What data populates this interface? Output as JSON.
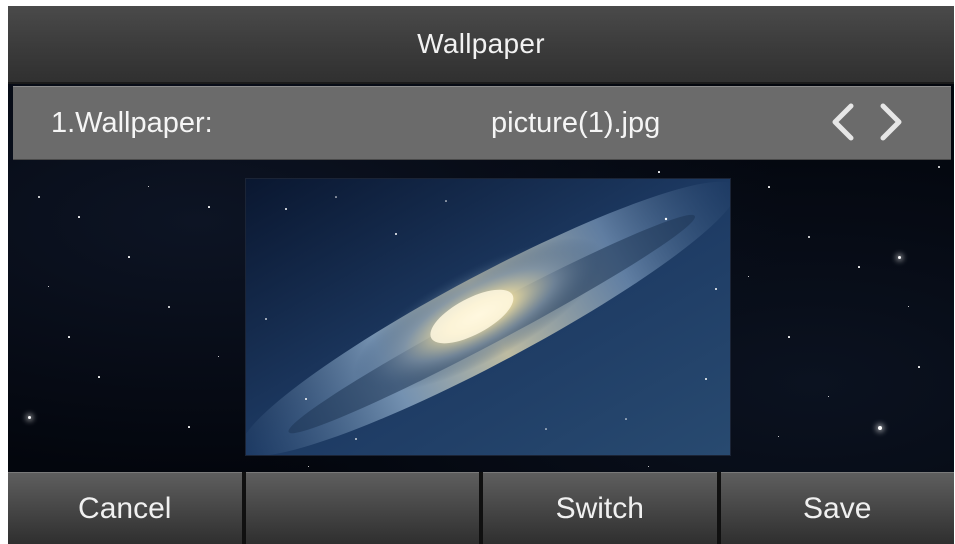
{
  "title": "Wallpaper",
  "setting": {
    "label": "1.Wallpaper:",
    "value": "picture(1).jpg",
    "prev_icon": "chevron-left-icon",
    "next_icon": "chevron-right-icon"
  },
  "softkeys": [
    "Cancel",
    "",
    "Switch",
    "Save"
  ],
  "colors": {
    "title_bar": "#3b3b3b",
    "setting_row": "#6b6b6b",
    "softkey": "#494949",
    "text": "#f5f5f5",
    "background": "#03060d"
  }
}
